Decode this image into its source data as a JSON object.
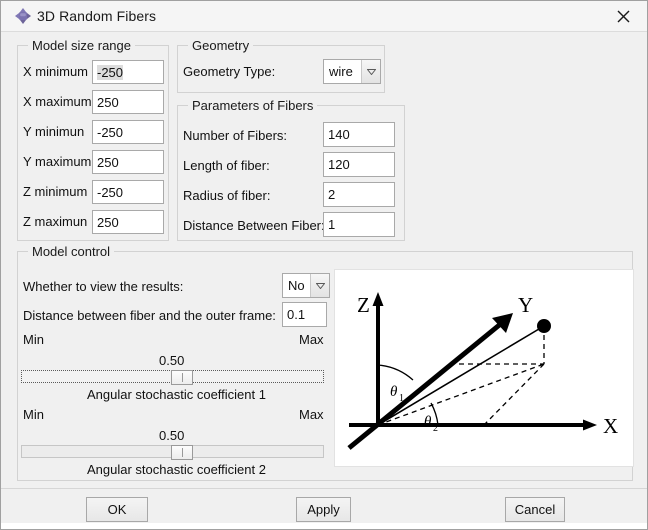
{
  "window": {
    "title": "3D Random Fibers",
    "icon": "move-diamond-icon",
    "close_label": "×"
  },
  "groups": {
    "model_size_range": {
      "title": "Model size range",
      "fields": [
        {
          "label": "X minimum",
          "value": "-250",
          "selected": true
        },
        {
          "label": "X maximum",
          "value": "250",
          "selected": false
        },
        {
          "label": "Y minimun",
          "value": "-250",
          "selected": false
        },
        {
          "label": "Y maximum",
          "value": "250",
          "selected": false
        },
        {
          "label": "Z minimum",
          "value": "-250",
          "selected": false
        },
        {
          "label": "Z maximun",
          "value": "250",
          "selected": false
        }
      ]
    },
    "geometry": {
      "title": "Geometry",
      "type_label": "Geometry Type:",
      "type_value": "wire"
    },
    "parameters_of_fibers": {
      "title": "Parameters of Fibers",
      "fields": [
        {
          "label": "Number of Fibers:",
          "value": "140"
        },
        {
          "label": "Length of fiber:",
          "value": "120"
        },
        {
          "label": "Radius of fiber:",
          "value": "2"
        },
        {
          "label": "Distance Between Fiber:",
          "value": "1"
        }
      ]
    },
    "model_control": {
      "title": "Model control",
      "view_results_label": "Whether to view the results:",
      "view_results_value": "No",
      "outer_frame_label": "Distance between fiber and the outer frame:",
      "outer_frame_value": "0.1",
      "sliders": [
        {
          "min_label": "Min",
          "max_label": "Max",
          "value": "0.50",
          "caption": "Angular stochastic coefficient 1",
          "focused": true
        },
        {
          "min_label": "Min",
          "max_label": "Max",
          "value": "0.50",
          "caption": "Angular stochastic coefficient 2",
          "focused": false
        }
      ]
    }
  },
  "diagram": {
    "name": "3d-angle-diagram",
    "axis_z": "Z",
    "axis_y": "Y",
    "axis_x": "X",
    "angle1": "θ",
    "angle1_sub": "1",
    "angle2": "θ",
    "angle2_sub": "2"
  },
  "buttons": {
    "ok": "OK",
    "apply": "Apply",
    "cancel": "Cancel"
  },
  "colors": {
    "dialog_bg": "#f0f0f0",
    "titlebar_bg": "#f5f5f5",
    "input_bg": "#ffffff",
    "border": "#a9a9a9",
    "group_border": "#d2d2d2",
    "icon_purple": "#7b72b0",
    "text": "#111111",
    "selection": "#dcdcdc"
  }
}
